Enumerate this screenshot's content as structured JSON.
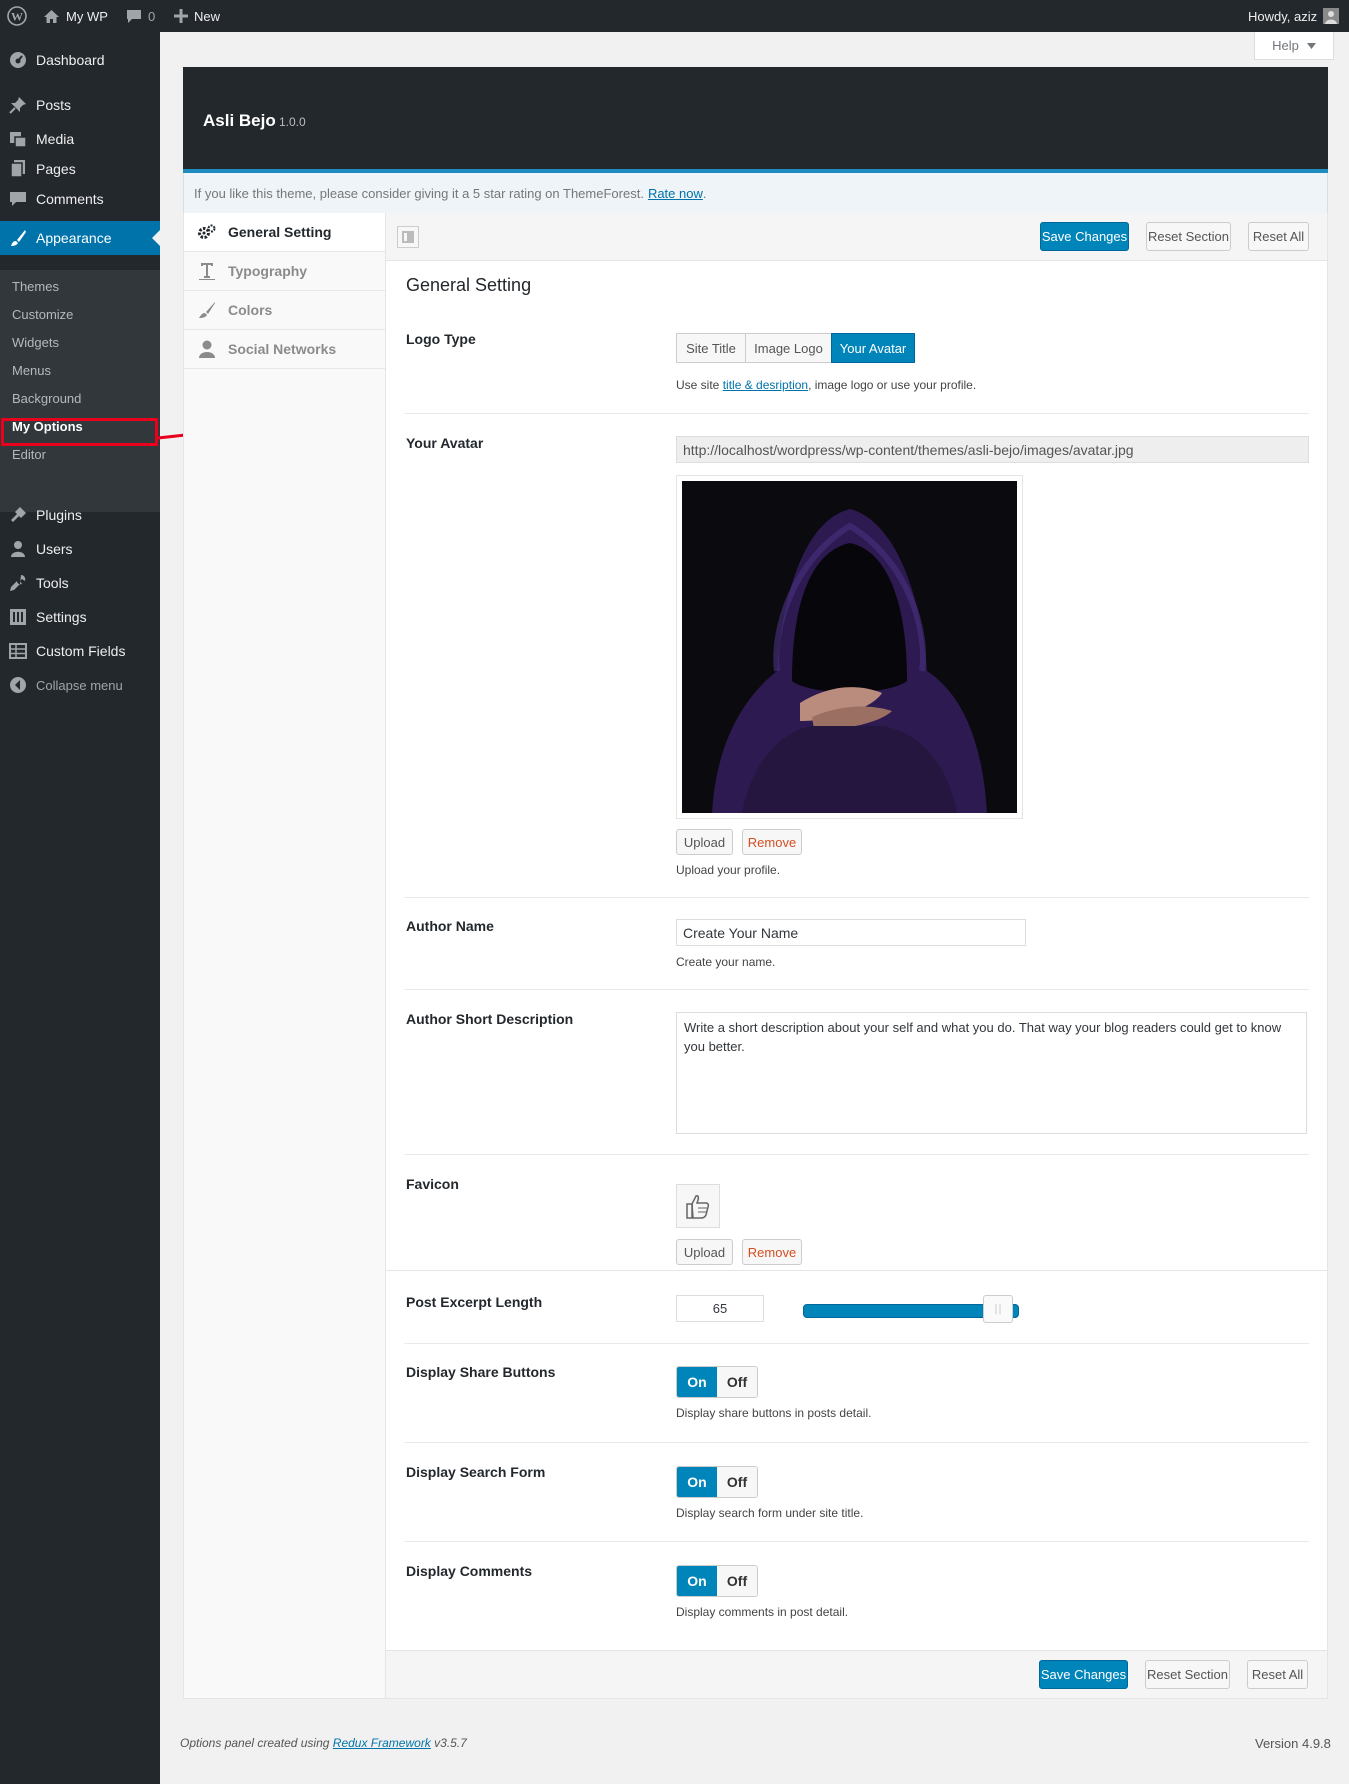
{
  "adminbar": {
    "site_name": "My WP",
    "comments_count": "0",
    "new_label": "New",
    "greeting": "Howdy, aziz"
  },
  "help_tab": {
    "label": "Help"
  },
  "sidebar": {
    "items": [
      {
        "label": "Dashboard",
        "icon": "dashboard-icon"
      },
      {
        "label": "Posts",
        "icon": "pin-icon"
      },
      {
        "label": "Media",
        "icon": "media-icon"
      },
      {
        "label": "Pages",
        "icon": "pages-icon"
      },
      {
        "label": "Comments",
        "icon": "comment-icon"
      },
      {
        "label": "Appearance",
        "icon": "brush-icon"
      },
      {
        "label": "Plugins",
        "icon": "plugin-icon"
      },
      {
        "label": "Users",
        "icon": "user-icon"
      },
      {
        "label": "Tools",
        "icon": "wrench-icon"
      },
      {
        "label": "Settings",
        "icon": "settings-icon"
      },
      {
        "label": "Custom Fields",
        "icon": "table-icon"
      },
      {
        "label": "Collapse menu",
        "icon": "collapse-icon"
      }
    ],
    "submenu": [
      "Themes",
      "Customize",
      "Widgets",
      "Menus",
      "Background",
      "My Options",
      "Editor"
    ]
  },
  "panel": {
    "title": "Asli Bejo",
    "version": "1.0.0",
    "notice_text": "If you like this theme, please consider giving it a 5 star rating on ThemeForest.",
    "notice_link": "Rate now",
    "notice_end": "."
  },
  "tabs": [
    "General Setting",
    "Typography",
    "Colors",
    "Social Networks"
  ],
  "toolbar": {
    "save": "Save Changes",
    "reset_section": "Reset Section",
    "reset_all": "Reset All"
  },
  "section": {
    "title": "General Setting",
    "logo_type": {
      "label": "Logo Type",
      "options": [
        "Site Title",
        "Image Logo",
        "Your Avatar"
      ],
      "selected": "Your Avatar",
      "desc_before": "Use site",
      "desc_link": "title & desription",
      "desc_after": ", image logo or use your profile."
    },
    "avatar": {
      "label": "Your Avatar",
      "url": "http://localhost/wordpress/wp-content/themes/asli-bejo/images/avatar.jpg",
      "upload": "Upload",
      "remove": "Remove",
      "desc": "Upload your profile."
    },
    "author_name": {
      "label": "Author Name",
      "value": "Create Your Name",
      "desc": "Create your name."
    },
    "author_desc": {
      "label": "Author Short Description",
      "value": "Write a short description about your self and what you do. That way your blog readers could get to know you better."
    },
    "favicon": {
      "label": "Favicon",
      "upload": "Upload",
      "remove": "Remove"
    },
    "excerpt": {
      "label": "Post Excerpt Length",
      "value": "65"
    },
    "share": {
      "label": "Display Share Buttons",
      "on": "On",
      "off": "Off",
      "desc": "Display share buttons in posts detail."
    },
    "search": {
      "label": "Display Search Form",
      "on": "On",
      "off": "Off",
      "desc": "Display search form under site title."
    },
    "comments": {
      "label": "Display Comments",
      "on": "On",
      "off": "Off",
      "desc": "Display comments in post detail."
    }
  },
  "footer": {
    "credit_before": "Options panel created using",
    "credit_link": "Redux Framework",
    "credit_after": "v3.5.7",
    "wp_version": "Version 4.9.8"
  },
  "colors": {
    "accent": "#0085ba",
    "sidebar": "#23282d",
    "highlight": "#e8001c"
  }
}
